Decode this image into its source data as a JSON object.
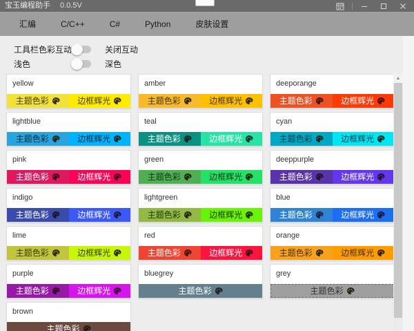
{
  "window": {
    "title": "宝玉编程助手",
    "version": "0.0.5V"
  },
  "menu": {
    "items": [
      "汇编",
      "C/C++",
      "C#",
      "Python",
      "皮肤设置"
    ]
  },
  "toggles": [
    {
      "label_left": "工具栏色彩互动",
      "label_right": "关闭互动",
      "state": "off"
    },
    {
      "label_left": "浅色",
      "label_right": "深色",
      "state": "off"
    }
  ],
  "card_buttons": {
    "theme": "主题色彩",
    "glow": "边框辉光"
  },
  "cards": [
    {
      "name": "yellow",
      "theme": "#f1e23b",
      "glow": "#ffeb00",
      "text": "#4a4000",
      "single": false,
      "dashed": false
    },
    {
      "name": "amber",
      "theme": "#f6ba2a",
      "glow": "#ffc000",
      "text": "#4a3000",
      "single": false,
      "dashed": false
    },
    {
      "name": "deeporange",
      "theme": "#ef5123",
      "glow": "#ff3a06",
      "text": "#ffffff",
      "single": false,
      "dashed": false
    },
    {
      "name": "lightblue",
      "theme": "#29a4df",
      "glow": "#00b3ff",
      "text": "#05293d",
      "single": false,
      "dashed": false
    },
    {
      "name": "teal",
      "theme": "#0b9184",
      "glow": "#28e2a6",
      "text": "#ffffff",
      "single": false,
      "dashed": false
    },
    {
      "name": "cyan",
      "theme": "#00a8c6",
      "glow": "#00e4f4",
      "text": "#043c44",
      "single": false,
      "dashed": false
    },
    {
      "name": "pink",
      "theme": "#e1185f",
      "glow": "#f80459",
      "text": "#ffffff",
      "single": false,
      "dashed": false
    },
    {
      "name": "green",
      "theme": "#50ae55",
      "glow": "#26e167",
      "text": "#0c3b13",
      "single": false,
      "dashed": false
    },
    {
      "name": "deeppurple",
      "theme": "#5833aa",
      "glow": "#6337ec",
      "text": "#ffffff",
      "single": false,
      "dashed": false
    },
    {
      "name": "indigo",
      "theme": "#3a4bae",
      "glow": "#3b59f8",
      "text": "#ffffff",
      "single": false,
      "dashed": false
    },
    {
      "name": "lightgreen",
      "theme": "#92b944",
      "glow": "#68f307",
      "text": "#203a05",
      "single": false,
      "dashed": false
    },
    {
      "name": "blue",
      "theme": "#2e83d6",
      "glow": "#1c6ff3",
      "text": "#ffffff",
      "single": false,
      "dashed": false
    },
    {
      "name": "lime",
      "theme": "#c1c53b",
      "glow": "#c8f608",
      "text": "#3c3d05",
      "single": false,
      "dashed": false
    },
    {
      "name": "red",
      "theme": "#f14533",
      "glow": "#fa143f",
      "text": "#ffffff",
      "single": false,
      "dashed": false
    },
    {
      "name": "orange",
      "theme": "#f7a11d",
      "glow": "#ff9d00",
      "text": "#4d2e00",
      "single": false,
      "dashed": false
    },
    {
      "name": "purple",
      "theme": "#9619a7",
      "glow": "#d713ee",
      "text": "#ffffff",
      "single": false,
      "dashed": false
    },
    {
      "name": "bluegrey",
      "theme": "#64808e",
      "glow": null,
      "text": "#ffffff",
      "single": true,
      "dashed": false
    },
    {
      "name": "grey",
      "theme": "#9f9f9f",
      "glow": null,
      "text": "#333333",
      "single": true,
      "dashed": true
    },
    {
      "name": "brown",
      "theme": "#6b4a40",
      "glow": null,
      "text": "#ffffff",
      "single": true,
      "dashed": false
    }
  ]
}
